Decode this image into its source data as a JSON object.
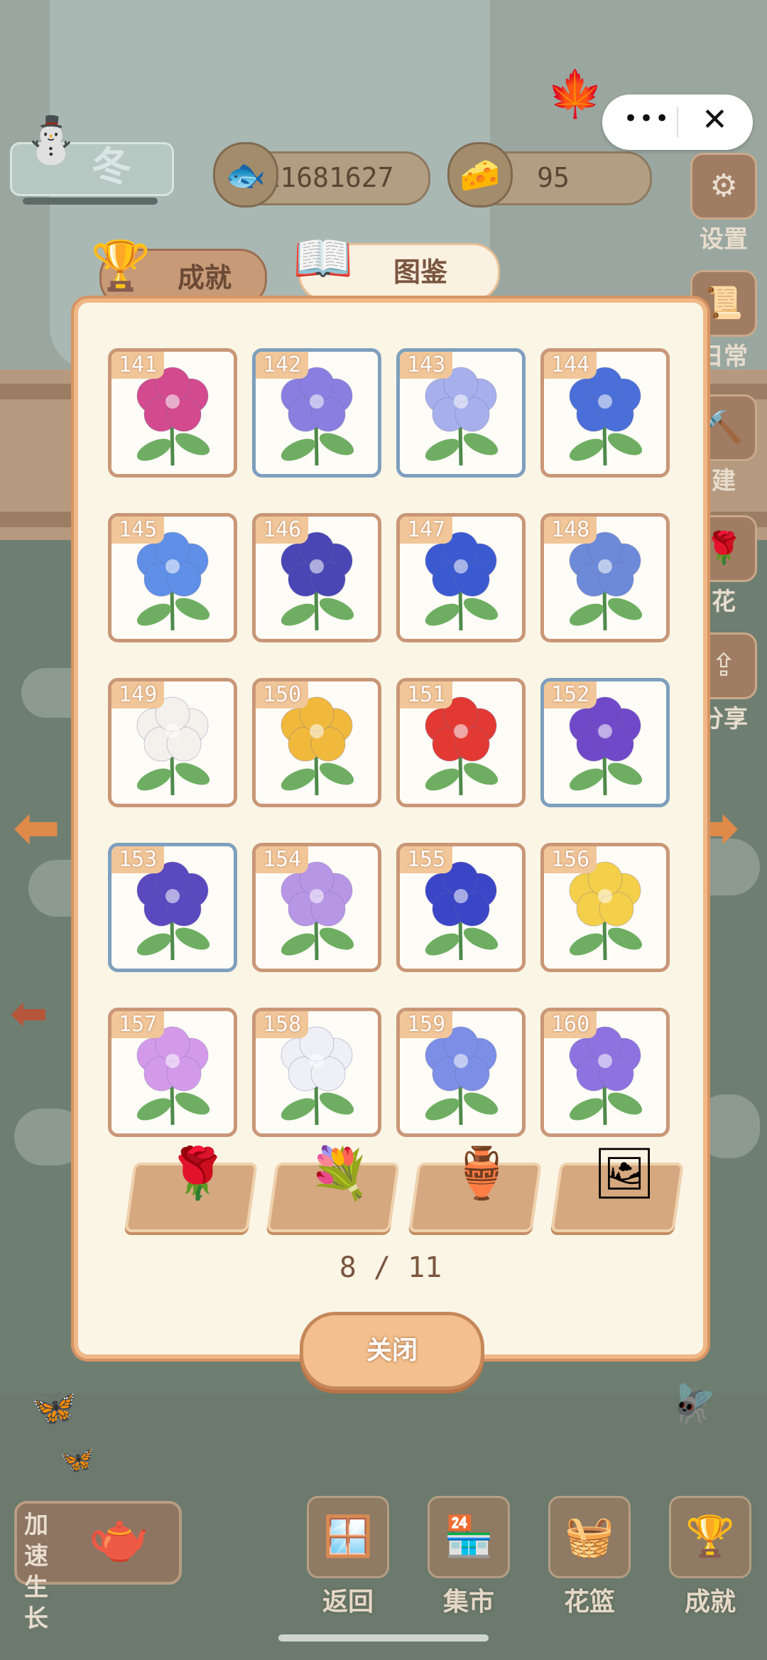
{
  "hud": {
    "season_label": "冬",
    "fish_count": "11681627",
    "cheese_count": "95"
  },
  "side_menu": [
    {
      "label": "设置",
      "icon": "gear-icon",
      "glyph": "⚙"
    },
    {
      "label": "日常",
      "icon": "scroll-icon",
      "glyph": "📜"
    },
    {
      "label": "建",
      "icon": "hammer-icon",
      "glyph": "🔨"
    },
    {
      "label": "花",
      "icon": "rose-icon",
      "glyph": "🌹"
    },
    {
      "label": "分享",
      "icon": "share-icon",
      "glyph": "⇪"
    }
  ],
  "tabs": {
    "achievements": "成就",
    "encyclopedia": "图鉴"
  },
  "flowers": [
    {
      "id": "141",
      "color": "#d34a8e",
      "frame": "brown"
    },
    {
      "id": "142",
      "color": "#8a7fe0",
      "frame": "blue"
    },
    {
      "id": "143",
      "color": "#a7b0ec",
      "frame": "blue"
    },
    {
      "id": "144",
      "color": "#4a6fd8",
      "frame": "brown"
    },
    {
      "id": "145",
      "color": "#5f8fe6",
      "frame": "brown"
    },
    {
      "id": "146",
      "color": "#4a47b5",
      "frame": "brown"
    },
    {
      "id": "147",
      "color": "#3c5ad0",
      "frame": "brown"
    },
    {
      "id": "148",
      "color": "#6c8ad8",
      "frame": "brown"
    },
    {
      "id": "149",
      "color": "#f4f1ec",
      "frame": "brown"
    },
    {
      "id": "150",
      "color": "#f0b93c",
      "frame": "brown"
    },
    {
      "id": "151",
      "color": "#e23a33",
      "frame": "brown"
    },
    {
      "id": "152",
      "color": "#7049c8",
      "frame": "blue"
    },
    {
      "id": "153",
      "color": "#5b49c0",
      "frame": "blue"
    },
    {
      "id": "154",
      "color": "#b896e6",
      "frame": "brown"
    },
    {
      "id": "155",
      "color": "#3b46c6",
      "frame": "brown"
    },
    {
      "id": "156",
      "color": "#f4cf4a",
      "frame": "brown"
    },
    {
      "id": "157",
      "color": "#d49aea",
      "frame": "brown"
    },
    {
      "id": "158",
      "color": "#eef0f6",
      "frame": "brown"
    },
    {
      "id": "159",
      "color": "#7c8ee6",
      "frame": "brown"
    },
    {
      "id": "160",
      "color": "#8e72e0",
      "frame": "brown"
    }
  ],
  "categories": [
    {
      "icon": "flower-category-icon",
      "glyph": "🌹"
    },
    {
      "icon": "bouquet-category-icon",
      "glyph": "💐"
    },
    {
      "icon": "vase-category-icon",
      "glyph": "🏺"
    },
    {
      "icon": "picture-category-icon",
      "glyph": "🖼"
    }
  ],
  "pager": "8 / 11",
  "close_label": "关闭",
  "bottom_nav": [
    {
      "label": "返回",
      "icon": "window-icon",
      "glyph": "🪟"
    },
    {
      "label": "集市",
      "icon": "market-icon",
      "glyph": "🏪"
    },
    {
      "label": "花篮",
      "icon": "basket-icon",
      "glyph": "🧺"
    },
    {
      "label": "成就",
      "icon": "trophy-icon",
      "glyph": "🏆"
    }
  ],
  "boost_label": "加速生长"
}
